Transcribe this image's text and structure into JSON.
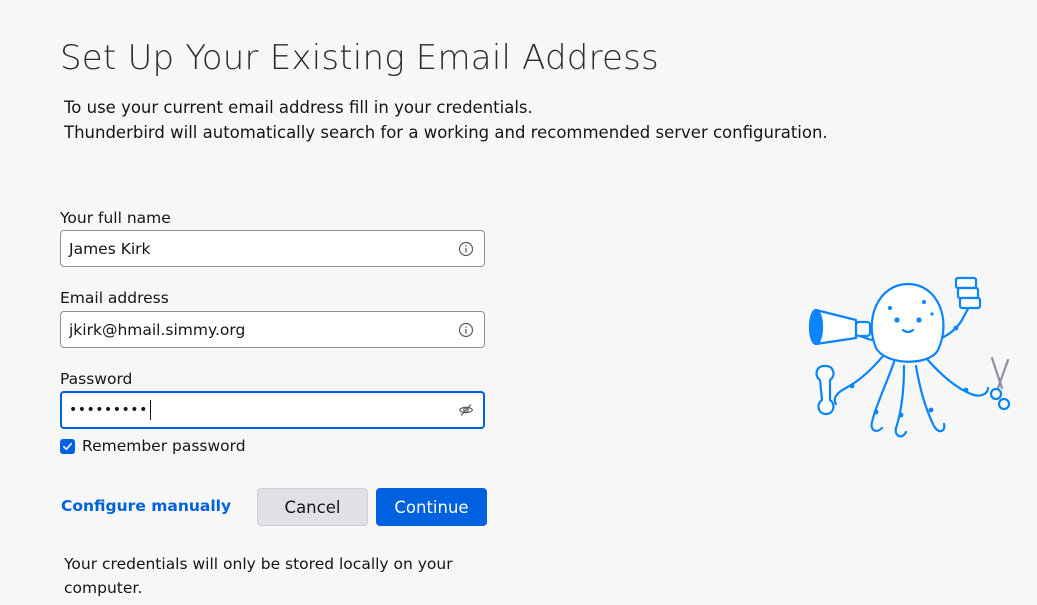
{
  "header": {
    "title": "Set Up Your Existing Email Address",
    "description_line1": "To use your current email address fill in your credentials.",
    "description_line2": "Thunderbird will automatically search for a working and recommended server configuration."
  },
  "form": {
    "full_name": {
      "label": "Your full name",
      "value": "James Kirk",
      "icon": "info-icon"
    },
    "email": {
      "label": "Email address",
      "value": "jkirk@hmail.simmy.org",
      "icon": "info-icon"
    },
    "password": {
      "label": "Password",
      "masked_value": "•••••••••",
      "icon": "eye-hidden-icon"
    },
    "remember": {
      "label": "Remember password",
      "checked": true
    }
  },
  "actions": {
    "configure_manually": "Configure manually",
    "cancel": "Cancel",
    "continue": "Continue"
  },
  "footer": {
    "note": "Your credentials will only be stored locally on your computer."
  },
  "colors": {
    "accent": "#0061e0",
    "background": "#f7f7f7",
    "mascot": "#0a84ff"
  }
}
